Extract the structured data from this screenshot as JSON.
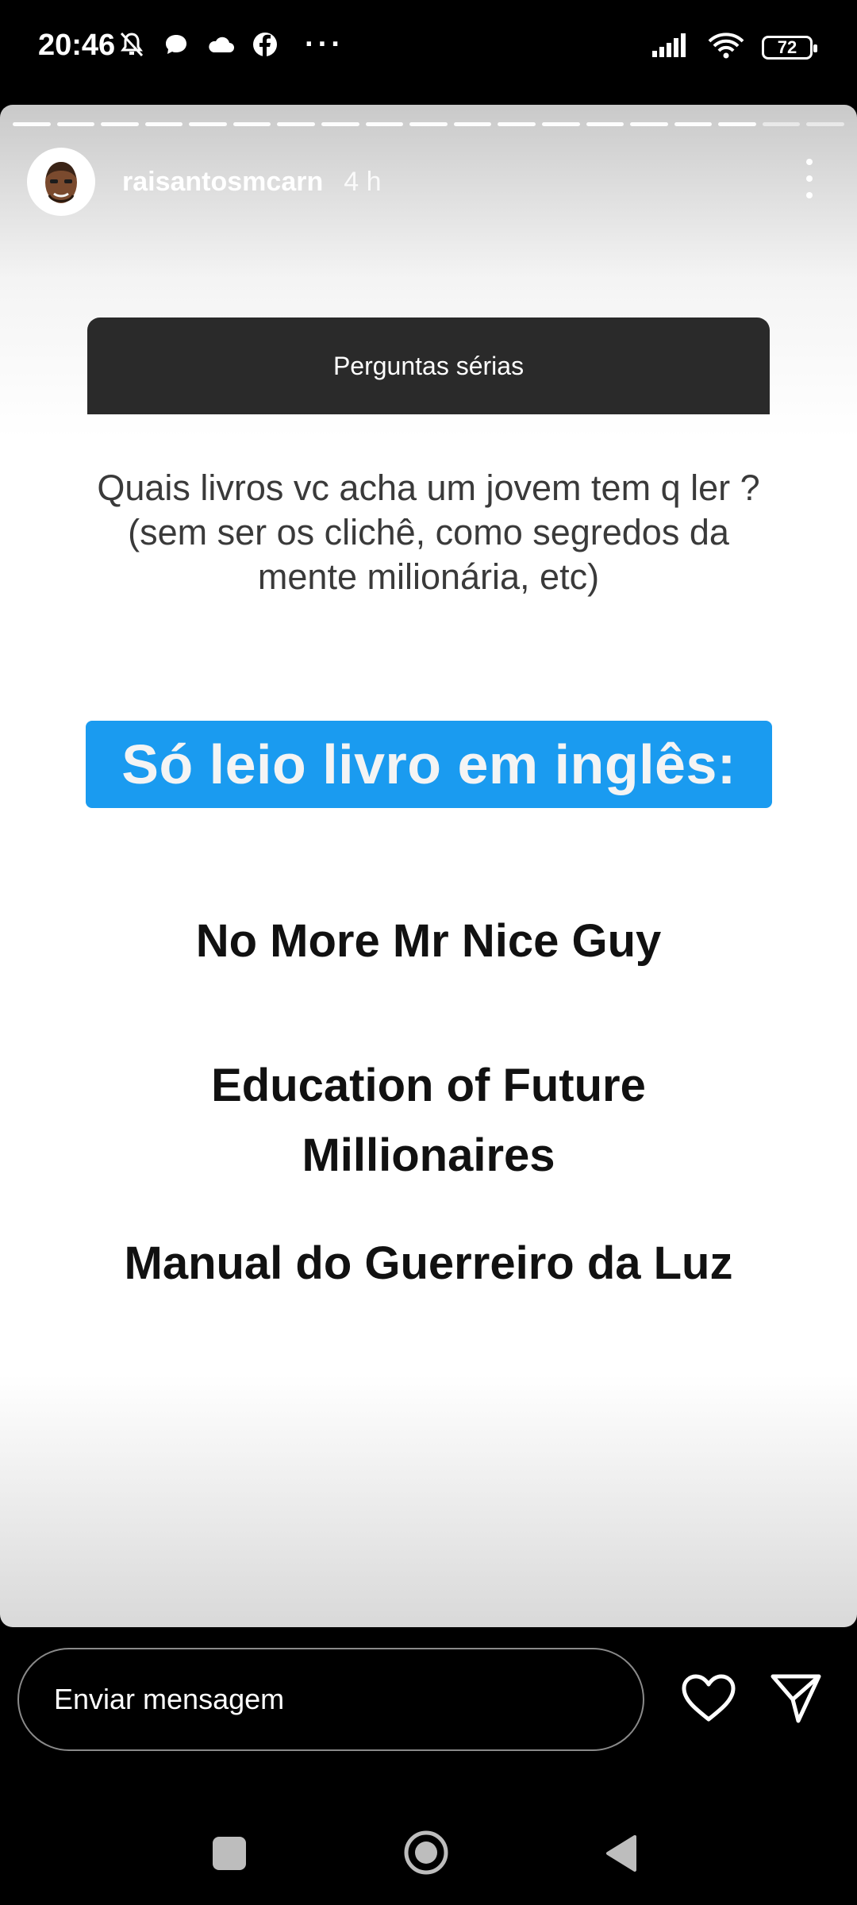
{
  "status_bar": {
    "time": "20:46",
    "battery": "72"
  },
  "story": {
    "username": "raisantosmcarn",
    "time_ago": "4 h",
    "question_title": "Perguntas sérias",
    "question_text": "Quais livros vc acha um jovem tem q ler ?(sem ser os clichê, como segredos da mente milionária, etc)",
    "highlight_text": "Só leio livro em inglês:",
    "books": [
      "No More Mr Nice Guy",
      "Education of Future Millionaires",
      "Manual do Guerreiro da Luz"
    ],
    "progress_segments": 19,
    "progress_viewed": 17
  },
  "reply_bar": {
    "placeholder": "Enviar mensagem"
  },
  "colors": {
    "highlight_bg": "#1a9bf0",
    "question_header_bg": "#2a2a2a"
  }
}
